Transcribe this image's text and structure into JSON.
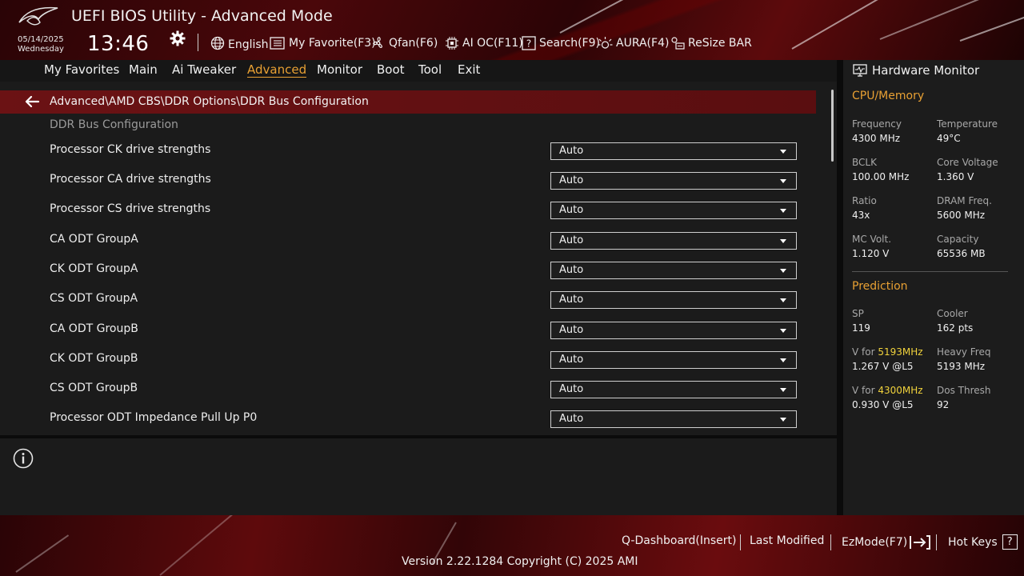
{
  "header": {
    "title": "UEFI BIOS Utility - Advanced Mode",
    "date": "05/14/2025",
    "weekday": "Wednesday",
    "time": "13:46",
    "toolbar": {
      "language": "English",
      "my_favorite": "My Favorite(F3)",
      "qfan": "Qfan(F6)",
      "ai_oc": "AI OC(F11)",
      "search": "Search(F9)",
      "aura": "AURA(F4)",
      "resize_bar": "ReSize BAR"
    }
  },
  "tabs": [
    "My Favorites",
    "Main",
    "Ai Tweaker",
    "Advanced",
    "Monitor",
    "Boot",
    "Tool",
    "Exit"
  ],
  "active_tab": "Advanced",
  "breadcrumb": "Advanced\\AMD CBS\\DDR Options\\DDR Bus Configuration",
  "section_title": "DDR Bus Configuration",
  "settings": [
    {
      "label": "Processor CK drive strengths",
      "value": "Auto"
    },
    {
      "label": "Processor CA drive strengths",
      "value": "Auto"
    },
    {
      "label": "Processor CS drive strengths",
      "value": "Auto"
    },
    {
      "label": "CA ODT GroupA",
      "value": "Auto"
    },
    {
      "label": "CK ODT GroupA",
      "value": "Auto"
    },
    {
      "label": "CS ODT GroupA",
      "value": "Auto"
    },
    {
      "label": "CA ODT GroupB",
      "value": "Auto"
    },
    {
      "label": "CK ODT GroupB",
      "value": "Auto"
    },
    {
      "label": "CS ODT GroupB",
      "value": "Auto"
    },
    {
      "label": "Processor ODT Impedance Pull Up P0",
      "value": "Auto"
    }
  ],
  "hardware_monitor": {
    "title": "Hardware Monitor",
    "cpu_memory": {
      "heading": "CPU/Memory",
      "frequency_label": "Frequency",
      "frequency": "4300 MHz",
      "temperature_label": "Temperature",
      "temperature": "49°C",
      "bclk_label": "BCLK",
      "bclk": "100.00 MHz",
      "core_voltage_label": "Core Voltage",
      "core_voltage": "1.360 V",
      "ratio_label": "Ratio",
      "ratio": "43x",
      "dram_freq_label": "DRAM Freq.",
      "dram_freq": "5600 MHz",
      "mc_volt_label": "MC Volt.",
      "mc_volt": "1.120 V",
      "capacity_label": "Capacity",
      "capacity": "65536 MB"
    },
    "prediction": {
      "heading": "Prediction",
      "sp_label": "SP",
      "sp": "119",
      "cooler_label": "Cooler",
      "cooler": "162 pts",
      "v_for_prefix": "V for ",
      "v_for_1_freq": "5193MHz",
      "v_for_1": "1.267 V @L5",
      "heavy_freq_label": "Heavy Freq",
      "heavy_freq": "5193 MHz",
      "v_for_2_freq": "4300MHz",
      "v_for_2": "0.930 V @L5",
      "dos_thresh_label": "Dos Thresh",
      "dos_thresh": "92"
    }
  },
  "footer": {
    "q_dashboard": "Q-Dashboard(Insert)",
    "last_modified": "Last Modified",
    "ezmode": "EzMode(F7)",
    "hot_keys": "Hot Keys",
    "hot_keys_glyph": "?",
    "version": "Version 2.22.1284 Copyright (C) 2025 AMI"
  },
  "colors": {
    "accent": "#e8a033",
    "highlight": "#f0d23c",
    "breadcrumb_bg": "#6b1214",
    "panel_bg": "#1b1b1b"
  }
}
